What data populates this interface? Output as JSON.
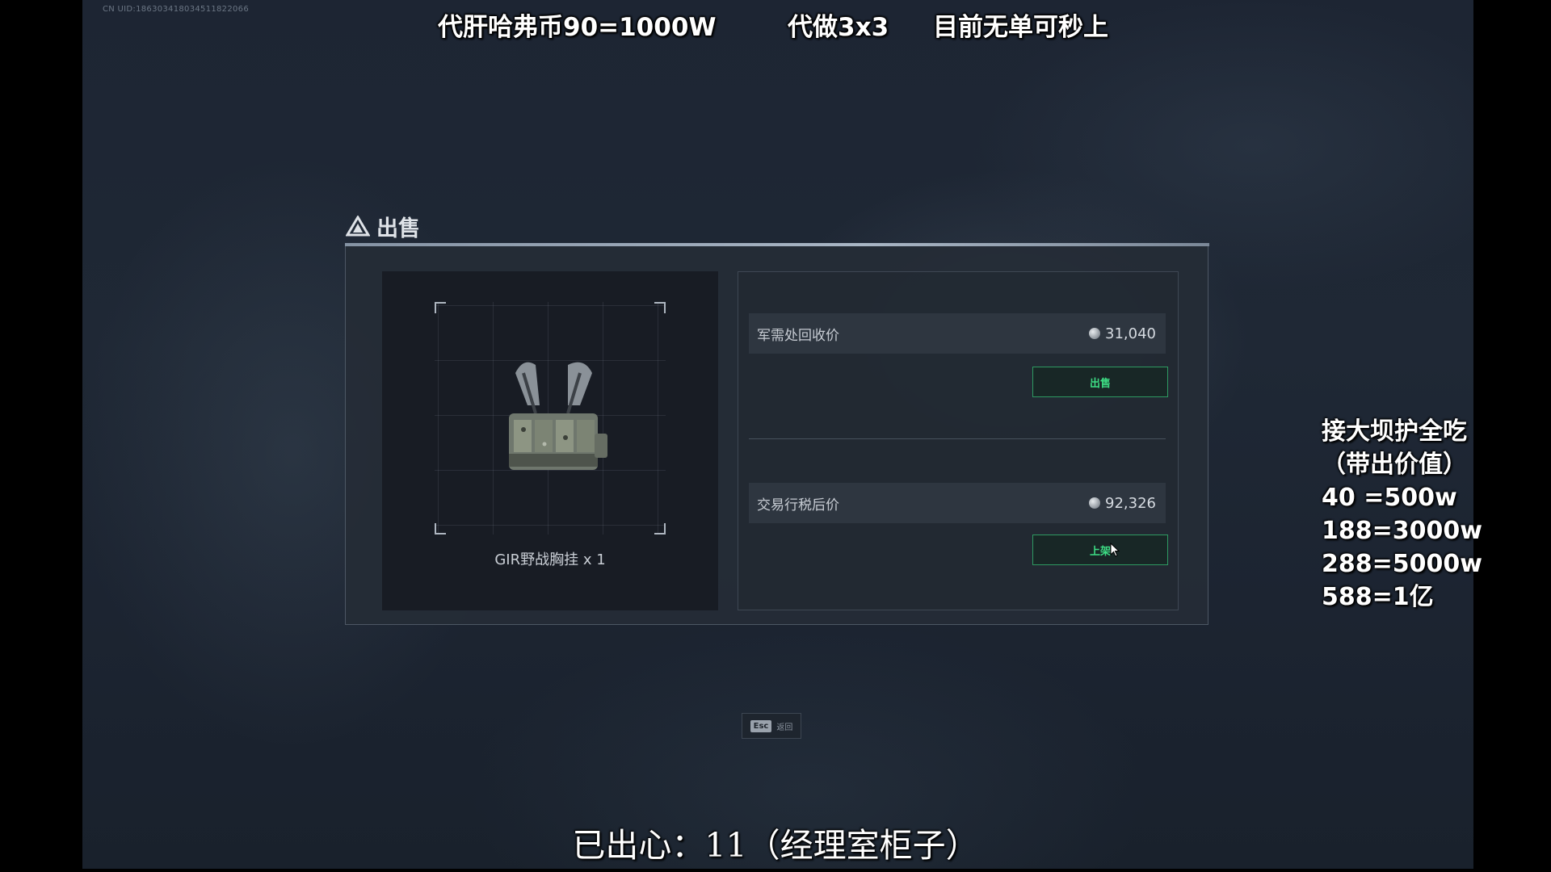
{
  "uid_text": "CN UID:18630341803451182206­6",
  "top_promos": [
    "代肝哈弗币90=1000W",
    "代做3x3",
    "目前无单可秒上"
  ],
  "side_promo": [
    "接大坝护全吃",
    "（带出价值）",
    "40 =500w",
    "188=3000w",
    "288=5000w",
    "588=1亿"
  ],
  "dialog": {
    "title": "出售",
    "item_name": "GIR野战胸挂 x 1",
    "recycle_label": "军需处回收价",
    "recycle_price": "31,040",
    "sell_button": "出售",
    "market_label": "交易行税后价",
    "market_price": "92,326",
    "list_button": "上架"
  },
  "esc_hint": {
    "key": "Esc",
    "label": "返回"
  },
  "subtitle": "已出心：11（经理室柜子）",
  "colors": {
    "accent_green": "#3ddc84",
    "button_border": "#2e9a62",
    "background": "#1d2533"
  },
  "icons": [
    "warning-triangle-icon",
    "coin-icon",
    "cursor-icon"
  ]
}
